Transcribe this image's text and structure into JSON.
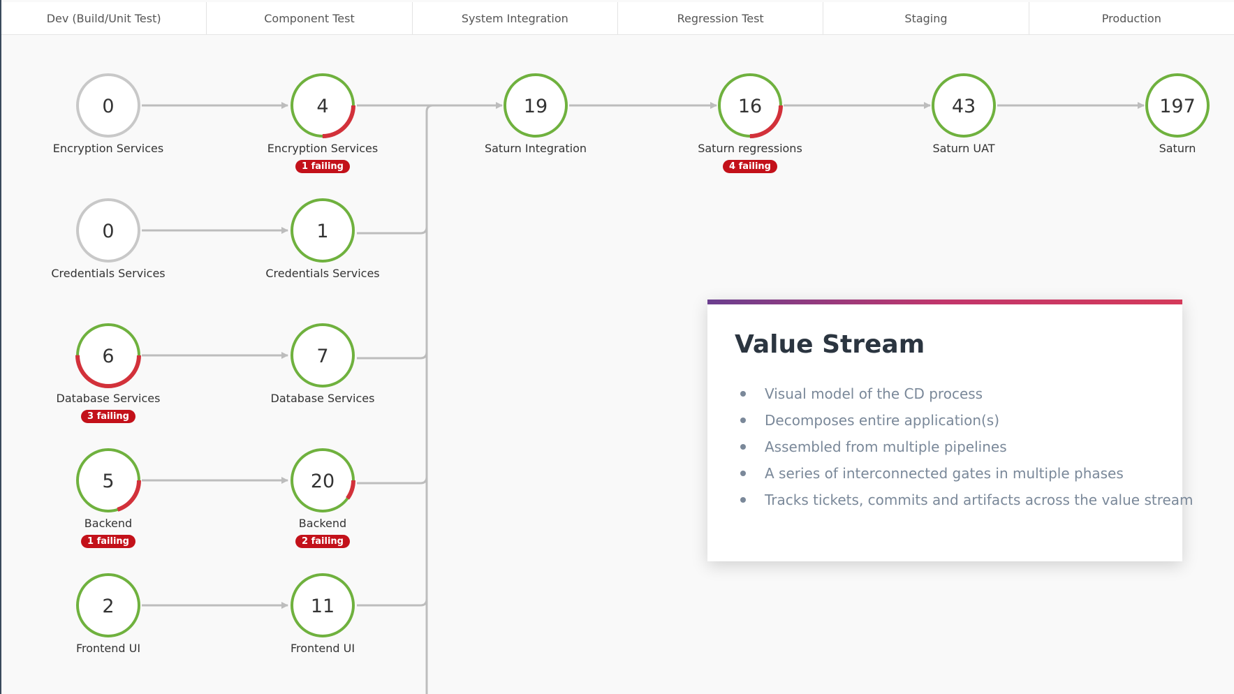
{
  "colors": {
    "ring_ok": "#6fb13e",
    "ring_fail": "#d2313a",
    "ring_idle": "#c8c8c8",
    "connector": "#bdbdbd",
    "badge_bg": "#c3111a"
  },
  "phases": [
    {
      "label": "Dev (Build/Unit Test)"
    },
    {
      "label": "Component Test"
    },
    {
      "label": "System Integration"
    },
    {
      "label": "Regression Test"
    },
    {
      "label": "Staging"
    },
    {
      "label": "Production"
    }
  ],
  "nodes": [
    {
      "id": "dev-encryption",
      "count": "0",
      "label": "Encryption Services",
      "badge": "",
      "status": "idle",
      "fail_fraction": 0
    },
    {
      "id": "comp-encryption",
      "count": "4",
      "label": "Encryption Services",
      "badge": "1 failing",
      "status": "ok",
      "fail_fraction": 0.25
    },
    {
      "id": "sys-integration",
      "count": "19",
      "label": "Saturn Integration",
      "badge": "",
      "status": "ok",
      "fail_fraction": 0
    },
    {
      "id": "reg-regressions",
      "count": "16",
      "label": "Saturn regressions",
      "badge": "4 failing",
      "status": "ok",
      "fail_fraction": 0.25
    },
    {
      "id": "staging-uat",
      "count": "43",
      "label": "Saturn UAT",
      "badge": "",
      "status": "ok",
      "fail_fraction": 0
    },
    {
      "id": "prod-saturn",
      "count": "197",
      "label": "Saturn",
      "badge": "",
      "status": "ok",
      "fail_fraction": 0
    },
    {
      "id": "dev-credentials",
      "count": "0",
      "label": "Credentials Services",
      "badge": "",
      "status": "idle",
      "fail_fraction": 0
    },
    {
      "id": "comp-credentials",
      "count": "1",
      "label": "Credentials Services",
      "badge": "",
      "status": "ok",
      "fail_fraction": 0
    },
    {
      "id": "dev-database",
      "count": "6",
      "label": "Database Services",
      "badge": "3 failing",
      "status": "ok",
      "fail_fraction": 0.5
    },
    {
      "id": "comp-database",
      "count": "7",
      "label": "Database Services",
      "badge": "",
      "status": "ok",
      "fail_fraction": 0
    },
    {
      "id": "dev-backend",
      "count": "5",
      "label": "Backend",
      "badge": "1 failing",
      "status": "ok",
      "fail_fraction": 0.2
    },
    {
      "id": "comp-backend",
      "count": "20",
      "label": "Backend",
      "badge": "2 failing",
      "status": "ok",
      "fail_fraction": 0.1
    },
    {
      "id": "dev-frontend",
      "count": "2",
      "label": "Frontend UI",
      "badge": "",
      "status": "ok",
      "fail_fraction": 0
    },
    {
      "id": "comp-frontend",
      "count": "11",
      "label": "Frontend UI",
      "badge": "",
      "status": "ok",
      "fail_fraction": 0
    }
  ],
  "card": {
    "title": "Value Stream",
    "bullets": [
      "Visual model of the CD process",
      "Decomposes entire application(s)",
      "Assembled from multiple pipelines",
      "A series of interconnected gates in multiple phases",
      "Tracks tickets, commits and artifacts across the value stream"
    ]
  }
}
